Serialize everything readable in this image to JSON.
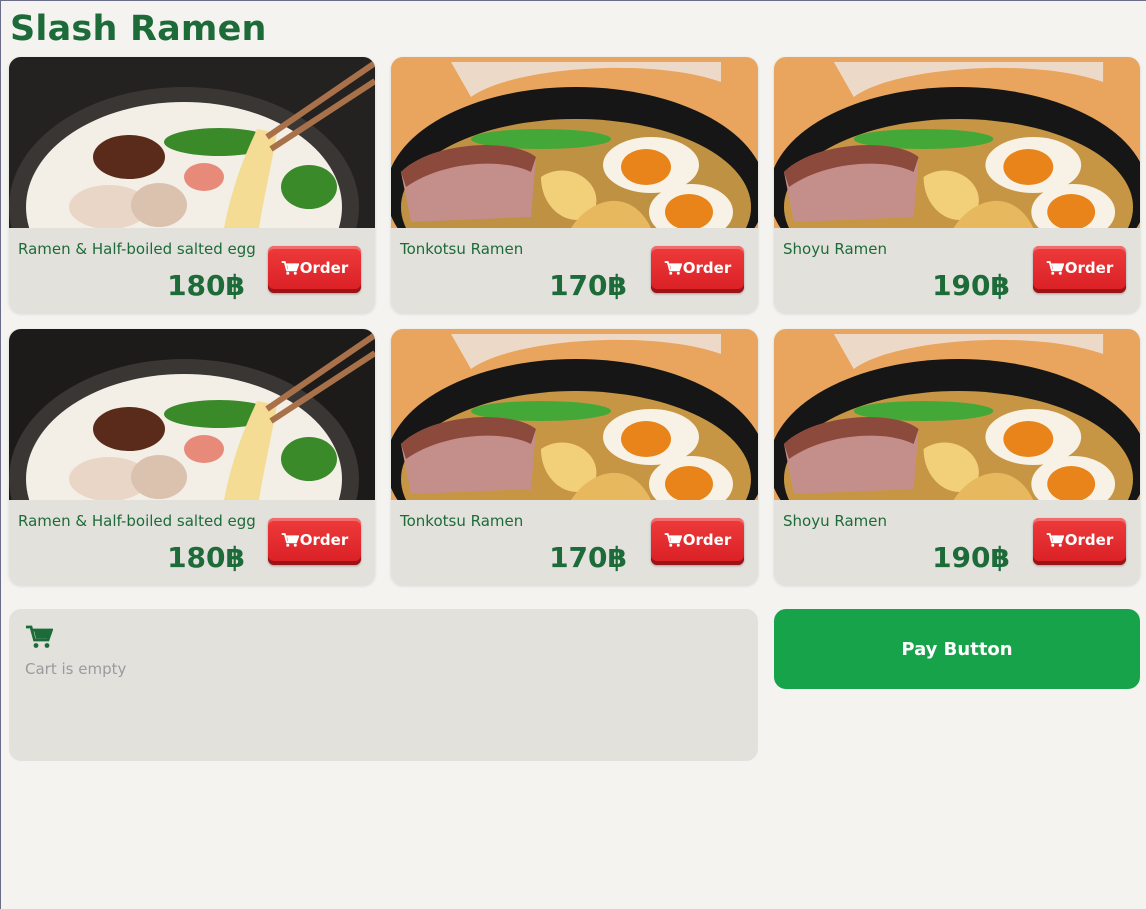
{
  "app": {
    "title": "Slash Ramen"
  },
  "menu": {
    "items": [
      {
        "name": "Ramen & Half-boiled salted egg",
        "price": "180฿",
        "order_label": "Order",
        "photo": "tonkotsu-chopsticks"
      },
      {
        "name": "Tonkotsu Ramen",
        "price": "170฿",
        "order_label": "Order",
        "photo": "ramen-egg-chashu"
      },
      {
        "name": "Shoyu Ramen",
        "price": "190฿",
        "order_label": "Order",
        "photo": "ramen-egg-chashu"
      },
      {
        "name": "Ramen & Half-boiled salted egg",
        "price": "180฿",
        "order_label": "Order",
        "photo": "tonkotsu-chopsticks"
      },
      {
        "name": "Tonkotsu Ramen",
        "price": "170฿",
        "order_label": "Order",
        "photo": "ramen-egg-chashu"
      },
      {
        "name": "Shoyu Ramen",
        "price": "190฿",
        "order_label": "Order",
        "photo": "ramen-egg-chashu"
      }
    ]
  },
  "cart": {
    "icon": "cart-icon",
    "empty_text": "Cart is empty"
  },
  "pay": {
    "label": "Pay Button"
  },
  "colors": {
    "brand_green": "#1e6b3a",
    "order_red": "#e0242a",
    "pay_green": "#17a34a"
  }
}
